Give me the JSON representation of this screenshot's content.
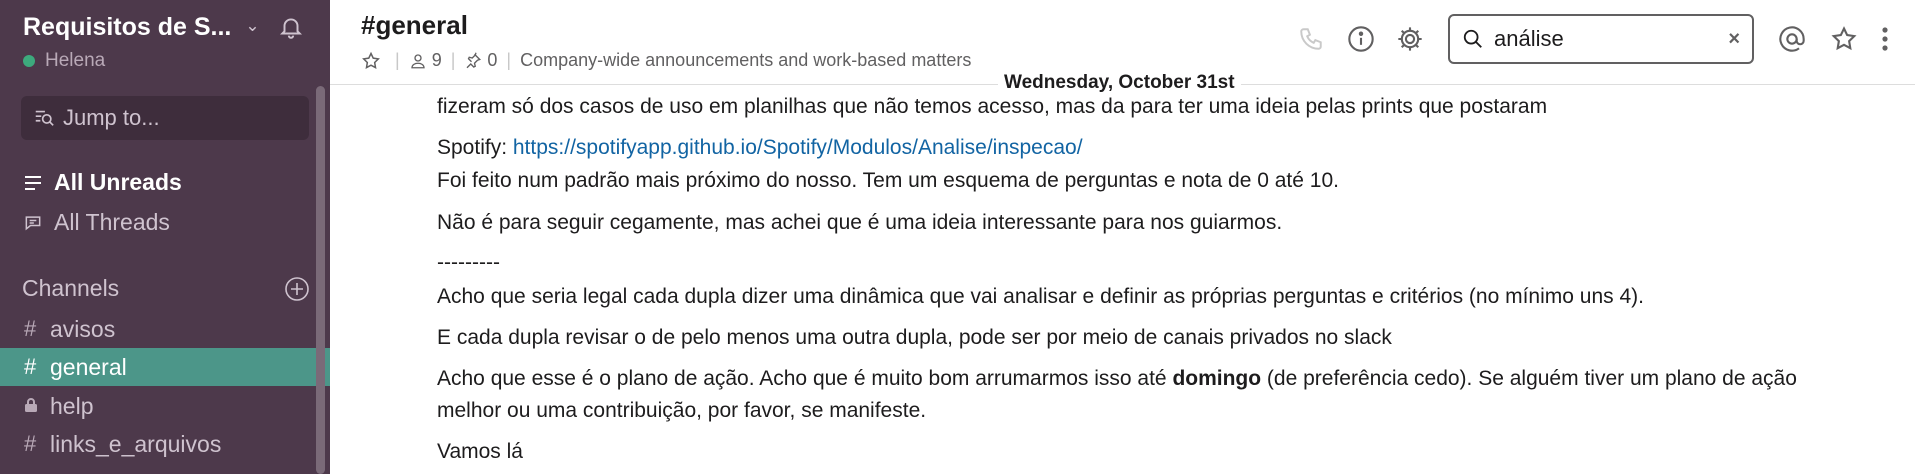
{
  "sidebar": {
    "team_name": "Requisitos de S...",
    "user_name": "Helena",
    "jump_to": "Jump to...",
    "all_unreads": "All Unreads",
    "all_threads": "All Threads",
    "channels_heading": "Channels",
    "channels": [
      {
        "prefix": "#",
        "name": "avisos",
        "active": false
      },
      {
        "prefix": "#",
        "name": "general",
        "active": true
      },
      {
        "prefix": "lock",
        "name": "help",
        "active": false
      },
      {
        "prefix": "#",
        "name": "links_e_arquivos",
        "active": false
      }
    ]
  },
  "header": {
    "channel_title": "#general",
    "members": "9",
    "pins": "0",
    "topic": "Company-wide announcements and work-based matters"
  },
  "search": {
    "value": "análise",
    "clear": "×"
  },
  "day_divider": "Wednesday, October 31st",
  "messages": {
    "m1": "fizeram só dos casos de uso em planilhas que não temos acesso, mas da para ter uma ideia pelas prints que postaram",
    "m2_prefix": "Spotify: ",
    "m2_link": "https://spotifyapp.github.io/Spotify/Modulos/Analise/inspecao/",
    "m3": "Foi feito num padrão mais próximo do nosso. Tem um esquema de perguntas e nota de 0 até 10.",
    "m4": "Não é para seguir cegamente, mas achei que é uma ideia interessante para nos guiarmos.",
    "m5": "---------",
    "m6": "Acho que seria legal cada dupla dizer uma dinâmica que vai analisar e definir as próprias perguntas e critérios (no mínimo uns 4).",
    "m7": "E cada dupla revisar o de pelo menos uma outra dupla, pode ser por meio de canais privados no slack",
    "m8_a": "Acho que esse é o plano de ação. Acho que é muito bom arrumarmos isso até ",
    "m8_bold": "domingo",
    "m8_b": " (de preferência cedo). Se alguém tiver um plano de ação",
    "m8_line2": "melhor ou uma contribuição, por favor, se manifeste.",
    "m9": "Vamos lá"
  },
  "colors": {
    "sidebar_bg": "#4d394b",
    "active_channel": "#4c9689",
    "link": "#1264a3",
    "presence": "#3daa7d"
  }
}
